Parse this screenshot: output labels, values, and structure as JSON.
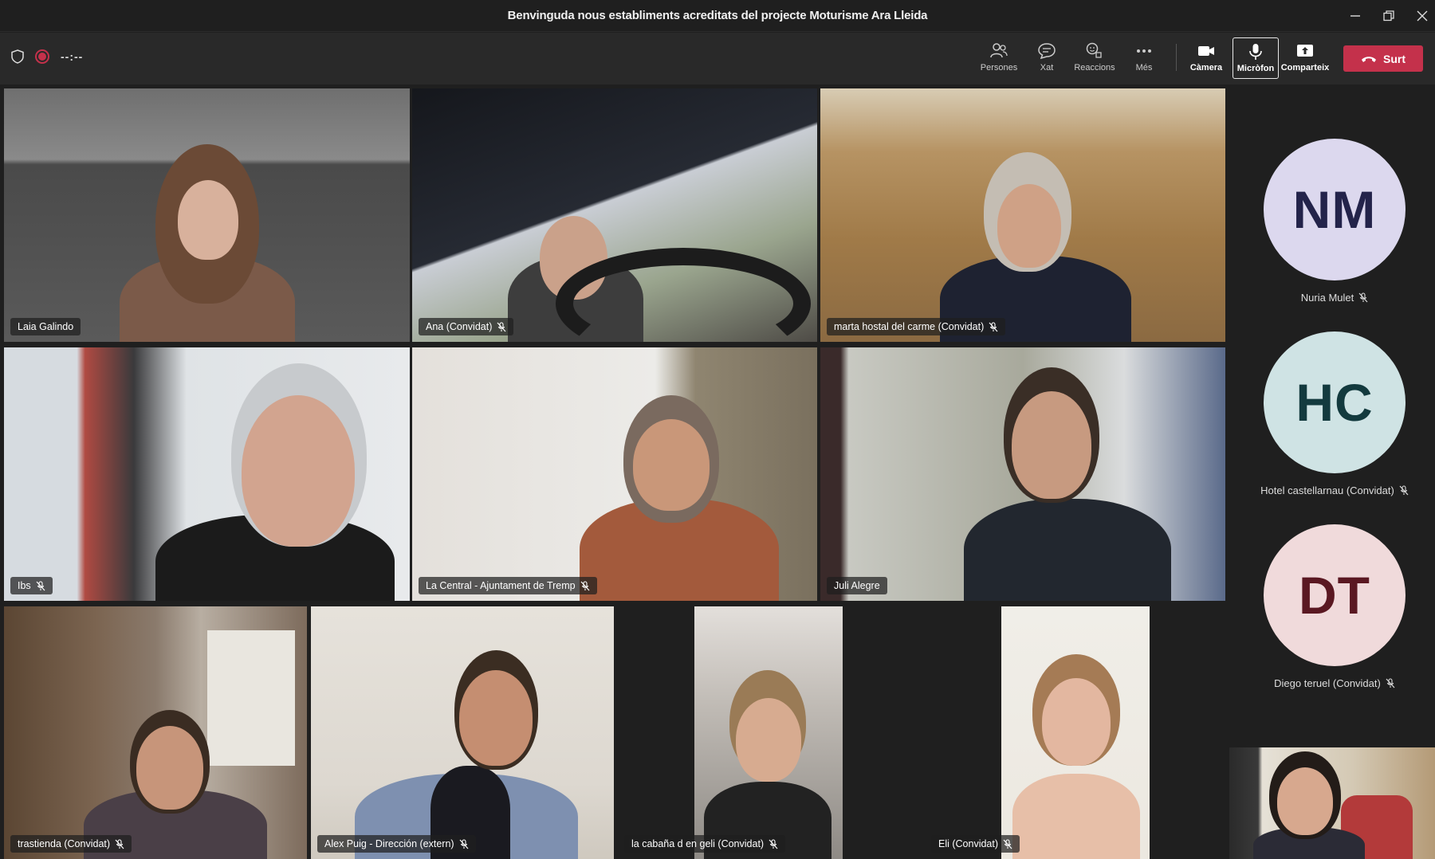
{
  "window": {
    "title": "Benvinguda nous establiments acreditats del projecte Moturisme Ara Lleida"
  },
  "toolbar": {
    "timer": "--:--",
    "buttons": [
      {
        "label": "Persones",
        "icon": "people-icon"
      },
      {
        "label": "Xat",
        "icon": "chat-icon"
      },
      {
        "label": "Reaccions",
        "icon": "reactions-icon"
      },
      {
        "label": "Més",
        "icon": "more-icon"
      },
      {
        "label": "Càmera",
        "icon": "camera-icon"
      },
      {
        "label": "Micròfon",
        "icon": "microphone-icon"
      },
      {
        "label": "Comparteix",
        "icon": "share-icon"
      }
    ],
    "leave_label": "Surt"
  },
  "participants": [
    {
      "name": "Laia Galindo",
      "muted": false,
      "speaking": true
    },
    {
      "name": "Ana (Convidat)",
      "muted": true
    },
    {
      "name": "marta hostal del carme (Convidat)",
      "muted": true
    },
    {
      "name": "Ibs",
      "muted": true
    },
    {
      "name": "La Central - Ajuntament de Tremp",
      "muted": true
    },
    {
      "name": "Juli Alegre",
      "muted": false
    },
    {
      "name": "trastienda (Convidat)",
      "muted": true
    },
    {
      "name": "Alex Puig - Dirección (extern)",
      "muted": true
    },
    {
      "name": "la cabaña d en geli (Convidat)",
      "muted": true
    },
    {
      "name": "Eli (Convidat)",
      "muted": true
    }
  ],
  "rail": [
    {
      "initials": "NM",
      "name": "Nuria Mulet",
      "muted": true,
      "bg": "#dcd8ee",
      "fg": "#23234a"
    },
    {
      "initials": "HC",
      "name": "Hotel castellarnau (Convidat)",
      "muted": true,
      "bg": "#cfe3e4",
      "fg": "#133a3e"
    },
    {
      "initials": "DT",
      "name": "Diego teruel (Convidat)",
      "muted": true,
      "bg": "#f0dadb",
      "fg": "#5a1822"
    }
  ],
  "colors": {
    "leave": "#c4314b",
    "speaking_outline": "#7f85f5"
  }
}
